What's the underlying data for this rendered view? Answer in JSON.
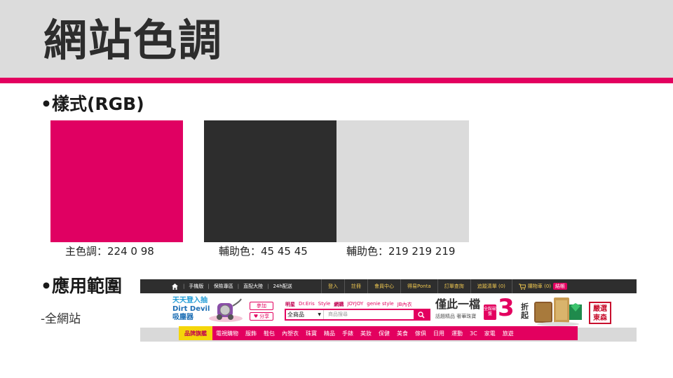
{
  "slide": {
    "title": "網站色調",
    "section1": "•樣式(RGB)",
    "section2": "•應用範圍",
    "section2_item": "-全網站"
  },
  "swatches": [
    {
      "color": "#e00062",
      "caption": "主色調：224  0  98"
    },
    {
      "color": "#2d2d2d",
      "caption": "輔助色：45  45  45"
    },
    {
      "color": "#dbdbdb",
      "caption": "輔助色：219  219  219"
    }
  ],
  "site": {
    "top_links": [
      "手機版",
      "保險專區",
      "直配大陸",
      "24h配送"
    ],
    "account_links": [
      "登入",
      "註冊",
      "會員中心",
      "得易Ponta",
      "訂單查詢",
      "追蹤清單 (0)"
    ],
    "cart_label": "購物車 (0)",
    "checkout_label": "結帳",
    "promo": {
      "line1": "天天登入抽",
      "line2": "Dirt Devil",
      "line3": "吸塵器",
      "btn1": "參加",
      "btn2": "分享"
    },
    "search": {
      "links": [
        "明星",
        "Dr.Eris",
        "Style",
        "網購",
        "JOYJOY",
        "genie style",
        "JB內衣"
      ],
      "scope": "全商品",
      "placeholder": "商品搜尋"
    },
    "sale": {
      "headline": "僅此一檔",
      "sub": "話題精品 奢華珠寶",
      "badge": "全館破盤",
      "number": "3",
      "unit": "折起"
    },
    "stamp": "嚴選東森",
    "categories": [
      "品牌旗艦",
      "電視購物",
      "服飾",
      "鞋包",
      "內塑衣",
      "珠寶",
      "精品",
      "手錶",
      "美妝",
      "保健",
      "美食",
      "傢俱",
      "日用",
      "運動",
      "3C",
      "家電",
      "旅遊"
    ]
  }
}
